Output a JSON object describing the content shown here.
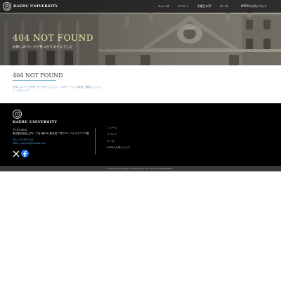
{
  "header": {
    "logo_text": "KAERU UNIVERSITY",
    "nav": [
      "ニュース",
      "イベント",
      "学業生の声",
      "コース",
      "KAERU大学について"
    ]
  },
  "hero": {
    "title": "404 NOT FOUND",
    "subtitle": "お探しのページが見つかりませんでした"
  },
  "main": {
    "title": "404 NOT FOUND",
    "message": "お探しのページが見つかりませんでした。TOPページより再度ご確認ください。",
    "link": "トップページへ"
  },
  "footer": {
    "logo_text": "KAERU UNIVERSITY",
    "postal": "〒103-0001",
    "address": "東京都渋谷区上門一丁目3番1号 東京虎ノ門グローバルスクエア1階",
    "tel": "TEL: 03-3333-44",
    "mail": "MAIL: sample@sdjsdo.net",
    "links": [
      "ニュース",
      "イベント",
      "コース",
      "KAERU大学について"
    ],
    "copyright": "COPYRIGHT KAERU UNIVERSITY ALL RIGHTS RESERVED."
  },
  "colors": {
    "hero_title": "#f1e9a6",
    "accent_rule": "#7fb6d6",
    "link": "#5a9bd0",
    "footer_bg": "#000000",
    "facebook": "#1877f2"
  },
  "icons": {
    "logo": "university-crest-icon",
    "x": "x-logo-icon",
    "facebook": "facebook-icon"
  }
}
